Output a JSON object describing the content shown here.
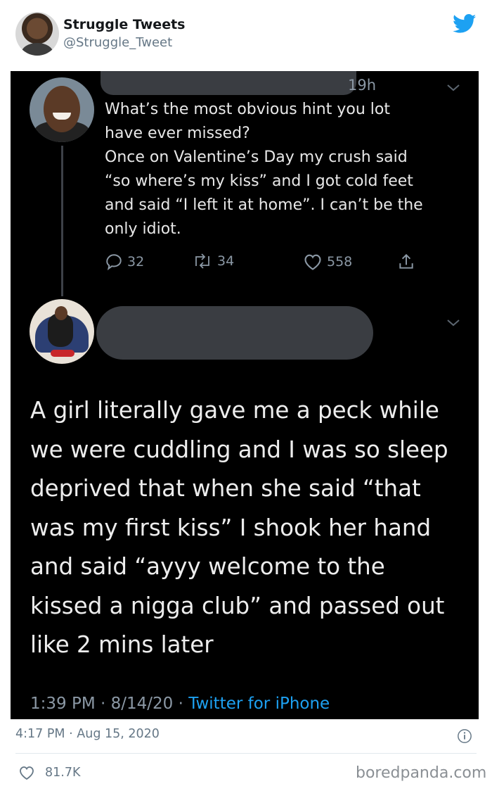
{
  "author": {
    "name": "Struggle Tweets",
    "handle": "@Struggle_Tweet"
  },
  "screenshot": {
    "tweet1": {
      "time": "19h",
      "text": "What’s the most obvious hint you lot\nhave ever missed?\nOnce on Valentine’s Day my crush said\n“so where’s my kiss” and I got cold feet\nand said “I left it at home”. I can’t be the\nonly idiot.",
      "replies": "32",
      "retweets": "34",
      "likes": "558"
    },
    "tweet2": {
      "text": "A girl literally gave me a peck while\nwe were cuddling and I was so sleep\ndeprived that when she said “that\nwas my first kiss” I shook her hand\nand said “ayyy welcome to the\nkissed a nigga club” and passed out\nlike 2 mins later",
      "time": "1:39 PM",
      "date": "8/14/20",
      "separator": "·",
      "source": "Twitter for iPhone"
    }
  },
  "footer": {
    "time": "4:17 PM",
    "date": "Aug 15, 2020",
    "separator": "·",
    "likes": "81.7K"
  },
  "watermark": "boredpanda.com",
  "colors": {
    "twitter_blue": "#1da1f2",
    "dark_bg": "#000000",
    "muted": "#657786"
  },
  "icons": [
    "twitter-bird-icon",
    "reply-icon",
    "retweet-icon",
    "like-icon",
    "share-icon",
    "chevron-down-icon",
    "info-icon",
    "heart-icon"
  ]
}
